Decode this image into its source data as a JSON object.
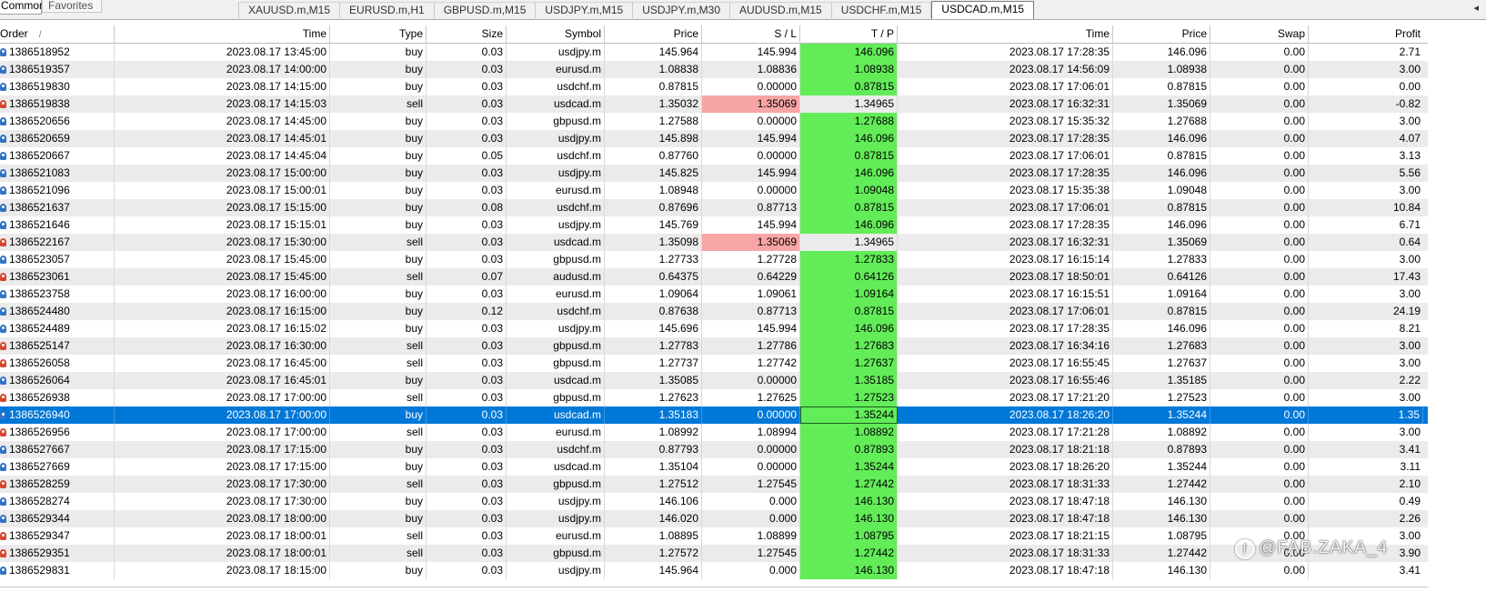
{
  "toolbar": {
    "common_label": "Common",
    "favorites_label": "Favorites"
  },
  "chart_tabs": [
    "XAUUSD.m,M15",
    "EURUSD.m,H1",
    "GBPUSD.m,M15",
    "USDJPY.m,M15",
    "USDJPY.m,M30",
    "AUDUSD.m,M15",
    "USDCHF.m,M15",
    "USDCAD.m,M15"
  ],
  "active_chart_tab": 7,
  "tab_scroll_label": "◂",
  "table": {
    "sort_indicator": "/",
    "headers": [
      "Order",
      "Time",
      "Type",
      "Size",
      "Symbol",
      "Price",
      "S / L",
      "T / P",
      "Time",
      "Price",
      "Swap",
      "Profit"
    ],
    "selected_row": 21,
    "rows": [
      {
        "order": "1386518952",
        "open_time": "2023.08.17 13:45:00",
        "type": "buy",
        "size": "0.03",
        "symbol": "usdjpy.m",
        "price": "145.964",
        "sl": "145.994",
        "tp": "146.096",
        "close_time": "2023.08.17 17:28:35",
        "close_price": "146.096",
        "swap": "0.00",
        "profit": "2.71",
        "hit": "tp"
      },
      {
        "order": "1386519357",
        "open_time": "2023.08.17 14:00:00",
        "type": "buy",
        "size": "0.03",
        "symbol": "eurusd.m",
        "price": "1.08838",
        "sl": "1.08836",
        "tp": "1.08938",
        "close_time": "2023.08.17 14:56:09",
        "close_price": "1.08938",
        "swap": "0.00",
        "profit": "3.00",
        "hit": "tp"
      },
      {
        "order": "1386519830",
        "open_time": "2023.08.17 14:15:00",
        "type": "buy",
        "size": "0.03",
        "symbol": "usdchf.m",
        "price": "0.87815",
        "sl": "0.00000",
        "tp": "0.87815",
        "close_time": "2023.08.17 17:06:01",
        "close_price": "0.87815",
        "swap": "0.00",
        "profit": "0.00",
        "hit": "tp"
      },
      {
        "order": "1386519838",
        "open_time": "2023.08.17 14:15:03",
        "type": "sell",
        "size": "0.03",
        "symbol": "usdcad.m",
        "price": "1.35032",
        "sl": "1.35069",
        "tp": "1.34965",
        "close_time": "2023.08.17 16:32:31",
        "close_price": "1.35069",
        "swap": "0.00",
        "profit": "-0.82",
        "hit": "sl"
      },
      {
        "order": "1386520656",
        "open_time": "2023.08.17 14:45:00",
        "type": "buy",
        "size": "0.03",
        "symbol": "gbpusd.m",
        "price": "1.27588",
        "sl": "0.00000",
        "tp": "1.27688",
        "close_time": "2023.08.17 15:35:32",
        "close_price": "1.27688",
        "swap": "0.00",
        "profit": "3.00",
        "hit": "tp"
      },
      {
        "order": "1386520659",
        "open_time": "2023.08.17 14:45:01",
        "type": "buy",
        "size": "0.03",
        "symbol": "usdjpy.m",
        "price": "145.898",
        "sl": "145.994",
        "tp": "146.096",
        "close_time": "2023.08.17 17:28:35",
        "close_price": "146.096",
        "swap": "0.00",
        "profit": "4.07",
        "hit": "tp"
      },
      {
        "order": "1386520667",
        "open_time": "2023.08.17 14:45:04",
        "type": "buy",
        "size": "0.05",
        "symbol": "usdchf.m",
        "price": "0.87760",
        "sl": "0.00000",
        "tp": "0.87815",
        "close_time": "2023.08.17 17:06:01",
        "close_price": "0.87815",
        "swap": "0.00",
        "profit": "3.13",
        "hit": "tp"
      },
      {
        "order": "1386521083",
        "open_time": "2023.08.17 15:00:00",
        "type": "buy",
        "size": "0.03",
        "symbol": "usdjpy.m",
        "price": "145.825",
        "sl": "145.994",
        "tp": "146.096",
        "close_time": "2023.08.17 17:28:35",
        "close_price": "146.096",
        "swap": "0.00",
        "profit": "5.56",
        "hit": "tp"
      },
      {
        "order": "1386521096",
        "open_time": "2023.08.17 15:00:01",
        "type": "buy",
        "size": "0.03",
        "symbol": "eurusd.m",
        "price": "1.08948",
        "sl": "0.00000",
        "tp": "1.09048",
        "close_time": "2023.08.17 15:35:38",
        "close_price": "1.09048",
        "swap": "0.00",
        "profit": "3.00",
        "hit": "tp"
      },
      {
        "order": "1386521637",
        "open_time": "2023.08.17 15:15:00",
        "type": "buy",
        "size": "0.08",
        "symbol": "usdchf.m",
        "price": "0.87696",
        "sl": "0.87713",
        "tp": "0.87815",
        "close_time": "2023.08.17 17:06:01",
        "close_price": "0.87815",
        "swap": "0.00",
        "profit": "10.84",
        "hit": "tp"
      },
      {
        "order": "1386521646",
        "open_time": "2023.08.17 15:15:01",
        "type": "buy",
        "size": "0.03",
        "symbol": "usdjpy.m",
        "price": "145.769",
        "sl": "145.994",
        "tp": "146.096",
        "close_time": "2023.08.17 17:28:35",
        "close_price": "146.096",
        "swap": "0.00",
        "profit": "6.71",
        "hit": "tp"
      },
      {
        "order": "1386522167",
        "open_time": "2023.08.17 15:30:00",
        "type": "sell",
        "size": "0.03",
        "symbol": "usdcad.m",
        "price": "1.35098",
        "sl": "1.35069",
        "tp": "1.34965",
        "close_time": "2023.08.17 16:32:31",
        "close_price": "1.35069",
        "swap": "0.00",
        "profit": "0.64",
        "hit": "sl"
      },
      {
        "order": "1386523057",
        "open_time": "2023.08.17 15:45:00",
        "type": "buy",
        "size": "0.03",
        "symbol": "gbpusd.m",
        "price": "1.27733",
        "sl": "1.27728",
        "tp": "1.27833",
        "close_time": "2023.08.17 16:15:14",
        "close_price": "1.27833",
        "swap": "0.00",
        "profit": "3.00",
        "hit": "tp"
      },
      {
        "order": "1386523061",
        "open_time": "2023.08.17 15:45:00",
        "type": "sell",
        "size": "0.07",
        "symbol": "audusd.m",
        "price": "0.64375",
        "sl": "0.64229",
        "tp": "0.64126",
        "close_time": "2023.08.17 18:50:01",
        "close_price": "0.64126",
        "swap": "0.00",
        "profit": "17.43",
        "hit": "tp"
      },
      {
        "order": "1386523758",
        "open_time": "2023.08.17 16:00:00",
        "type": "buy",
        "size": "0.03",
        "symbol": "eurusd.m",
        "price": "1.09064",
        "sl": "1.09061",
        "tp": "1.09164",
        "close_time": "2023.08.17 16:15:51",
        "close_price": "1.09164",
        "swap": "0.00",
        "profit": "3.00",
        "hit": "tp"
      },
      {
        "order": "1386524480",
        "open_time": "2023.08.17 16:15:00",
        "type": "buy",
        "size": "0.12",
        "symbol": "usdchf.m",
        "price": "0.87638",
        "sl": "0.87713",
        "tp": "0.87815",
        "close_time": "2023.08.17 17:06:01",
        "close_price": "0.87815",
        "swap": "0.00",
        "profit": "24.19",
        "hit": "tp"
      },
      {
        "order": "1386524489",
        "open_time": "2023.08.17 16:15:02",
        "type": "buy",
        "size": "0.03",
        "symbol": "usdjpy.m",
        "price": "145.696",
        "sl": "145.994",
        "tp": "146.096",
        "close_time": "2023.08.17 17:28:35",
        "close_price": "146.096",
        "swap": "0.00",
        "profit": "8.21",
        "hit": "tp"
      },
      {
        "order": "1386525147",
        "open_time": "2023.08.17 16:30:00",
        "type": "sell",
        "size": "0.03",
        "symbol": "gbpusd.m",
        "price": "1.27783",
        "sl": "1.27786",
        "tp": "1.27683",
        "close_time": "2023.08.17 16:34:16",
        "close_price": "1.27683",
        "swap": "0.00",
        "profit": "3.00",
        "hit": "tp"
      },
      {
        "order": "1386526058",
        "open_time": "2023.08.17 16:45:00",
        "type": "sell",
        "size": "0.03",
        "symbol": "gbpusd.m",
        "price": "1.27737",
        "sl": "1.27742",
        "tp": "1.27637",
        "close_time": "2023.08.17 16:55:45",
        "close_price": "1.27637",
        "swap": "0.00",
        "profit": "3.00",
        "hit": "tp"
      },
      {
        "order": "1386526064",
        "open_time": "2023.08.17 16:45:01",
        "type": "buy",
        "size": "0.03",
        "symbol": "usdcad.m",
        "price": "1.35085",
        "sl": "0.00000",
        "tp": "1.35185",
        "close_time": "2023.08.17 16:55:46",
        "close_price": "1.35185",
        "swap": "0.00",
        "profit": "2.22",
        "hit": "tp"
      },
      {
        "order": "1386526938",
        "open_time": "2023.08.17 17:00:00",
        "type": "sell",
        "size": "0.03",
        "symbol": "gbpusd.m",
        "price": "1.27623",
        "sl": "1.27625",
        "tp": "1.27523",
        "close_time": "2023.08.17 17:21:20",
        "close_price": "1.27523",
        "swap": "0.00",
        "profit": "3.00",
        "hit": "tp"
      },
      {
        "order": "1386526940",
        "open_time": "2023.08.17 17:00:00",
        "type": "buy",
        "size": "0.03",
        "symbol": "usdcad.m",
        "price": "1.35183",
        "sl": "0.00000",
        "tp": "1.35244",
        "close_time": "2023.08.17 18:26:20",
        "close_price": "1.35244",
        "swap": "0.00",
        "profit": "1.35",
        "hit": "tp"
      },
      {
        "order": "1386526956",
        "open_time": "2023.08.17 17:00:00",
        "type": "sell",
        "size": "0.03",
        "symbol": "eurusd.m",
        "price": "1.08992",
        "sl": "1.08994",
        "tp": "1.08892",
        "close_time": "2023.08.17 17:21:28",
        "close_price": "1.08892",
        "swap": "0.00",
        "profit": "3.00",
        "hit": "tp"
      },
      {
        "order": "1386527667",
        "open_time": "2023.08.17 17:15:00",
        "type": "buy",
        "size": "0.03",
        "symbol": "usdchf.m",
        "price": "0.87793",
        "sl": "0.00000",
        "tp": "0.87893",
        "close_time": "2023.08.17 18:21:18",
        "close_price": "0.87893",
        "swap": "0.00",
        "profit": "3.41",
        "hit": "tp"
      },
      {
        "order": "1386527669",
        "open_time": "2023.08.17 17:15:00",
        "type": "buy",
        "size": "0.03",
        "symbol": "usdcad.m",
        "price": "1.35104",
        "sl": "0.00000",
        "tp": "1.35244",
        "close_time": "2023.08.17 18:26:20",
        "close_price": "1.35244",
        "swap": "0.00",
        "profit": "3.11",
        "hit": "tp"
      },
      {
        "order": "1386528259",
        "open_time": "2023.08.17 17:30:00",
        "type": "sell",
        "size": "0.03",
        "symbol": "gbpusd.m",
        "price": "1.27512",
        "sl": "1.27545",
        "tp": "1.27442",
        "close_time": "2023.08.17 18:31:33",
        "close_price": "1.27442",
        "swap": "0.00",
        "profit": "2.10",
        "hit": "tp"
      },
      {
        "order": "1386528274",
        "open_time": "2023.08.17 17:30:00",
        "type": "buy",
        "size": "0.03",
        "symbol": "usdjpy.m",
        "price": "146.106",
        "sl": "0.000",
        "tp": "146.130",
        "close_time": "2023.08.17 18:47:18",
        "close_price": "146.130",
        "swap": "0.00",
        "profit": "0.49",
        "hit": "tp"
      },
      {
        "order": "1386529344",
        "open_time": "2023.08.17 18:00:00",
        "type": "buy",
        "size": "0.03",
        "symbol": "usdjpy.m",
        "price": "146.020",
        "sl": "0.000",
        "tp": "146.130",
        "close_time": "2023.08.17 18:47:18",
        "close_price": "146.130",
        "swap": "0.00",
        "profit": "2.26",
        "hit": "tp"
      },
      {
        "order": "1386529347",
        "open_time": "2023.08.17 18:00:01",
        "type": "sell",
        "size": "0.03",
        "symbol": "eurusd.m",
        "price": "1.08895",
        "sl": "1.08899",
        "tp": "1.08795",
        "close_time": "2023.08.17 18:21:15",
        "close_price": "1.08795",
        "swap": "0.00",
        "profit": "3.00",
        "hit": "tp"
      },
      {
        "order": "1386529351",
        "open_time": "2023.08.17 18:00:01",
        "type": "sell",
        "size": "0.03",
        "symbol": "gbpusd.m",
        "price": "1.27572",
        "sl": "1.27545",
        "tp": "1.27442",
        "close_time": "2023.08.17 18:31:33",
        "close_price": "1.27442",
        "swap": "0.00",
        "profit": "3.90",
        "hit": "tp"
      },
      {
        "order": "1386529831",
        "open_time": "2023.08.17 18:15:00",
        "type": "buy",
        "size": "0.03",
        "symbol": "usdjpy.m",
        "price": "145.964",
        "sl": "0.000",
        "tp": "146.130",
        "close_time": "2023.08.17 18:47:18",
        "close_price": "146.130",
        "swap": "0.00",
        "profit": "3.41",
        "hit": "tp"
      }
    ]
  },
  "watermark": "@FAB.ZAKA_4",
  "colors": {
    "tp_hit": "#62ec58",
    "sl_hit": "#f8a5a5",
    "selection": "#0078d7",
    "alt_row": "#ebebeb"
  }
}
